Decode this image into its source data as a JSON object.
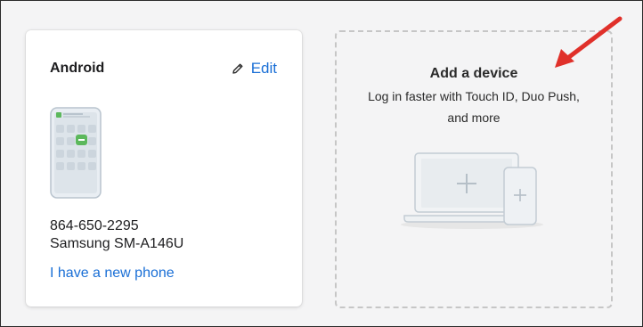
{
  "device_card": {
    "title": "Android",
    "edit_label": "Edit",
    "phone_number": "864-650-2295",
    "model": "Samsung SM-A146U",
    "new_phone_link": "I have a new phone"
  },
  "add_device_card": {
    "title": "Add a device",
    "description_line1": "Log in faster with Touch ID, Duo Push,",
    "description_line2": "and more"
  },
  "icons": {
    "edit": "pencil-icon",
    "phone": "android-phone-illustration",
    "add_devices": "laptop-and-phone-add-illustration",
    "annotation": "red-arrow-annotation"
  },
  "colors": {
    "link": "#1a6fd6",
    "accent_green": "#5cb85c",
    "annotation_red": "#e0302a",
    "dashed_border": "#c6c6c6"
  }
}
